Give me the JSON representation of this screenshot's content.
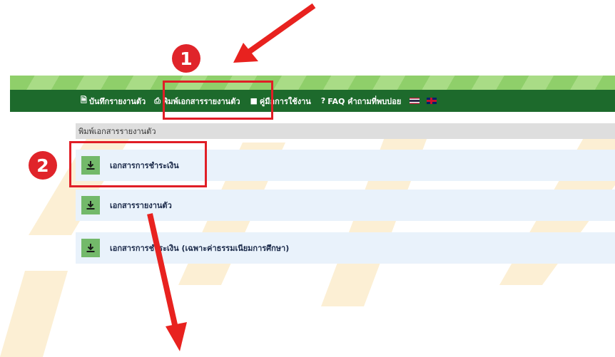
{
  "nav": {
    "items": [
      {
        "label": "บันทึกรายงานตัว"
      },
      {
        "label": "พิมพ์เอกสารรายงานตัว"
      },
      {
        "label": "คู่มือการใช้งาน"
      },
      {
        "label": "FAQ คำถามที่พบบ่อย"
      }
    ]
  },
  "section": {
    "title": "พิมพ์เอกสารรายงานตัว"
  },
  "documents": [
    {
      "label": "เอกสารการชำระเงิน"
    },
    {
      "label": "เอกสารรายงานตัว"
    },
    {
      "label": "เอกสารการชำระเงิน (เฉพาะค่าธรรมเนียมการศึกษา)"
    }
  ],
  "annotations": {
    "step1": "1",
    "step2": "2"
  },
  "colors": {
    "navbar": "#1d6a2c",
    "highlight": "#e01e26",
    "download": "#73b96a",
    "row": "#e9f2fb"
  }
}
